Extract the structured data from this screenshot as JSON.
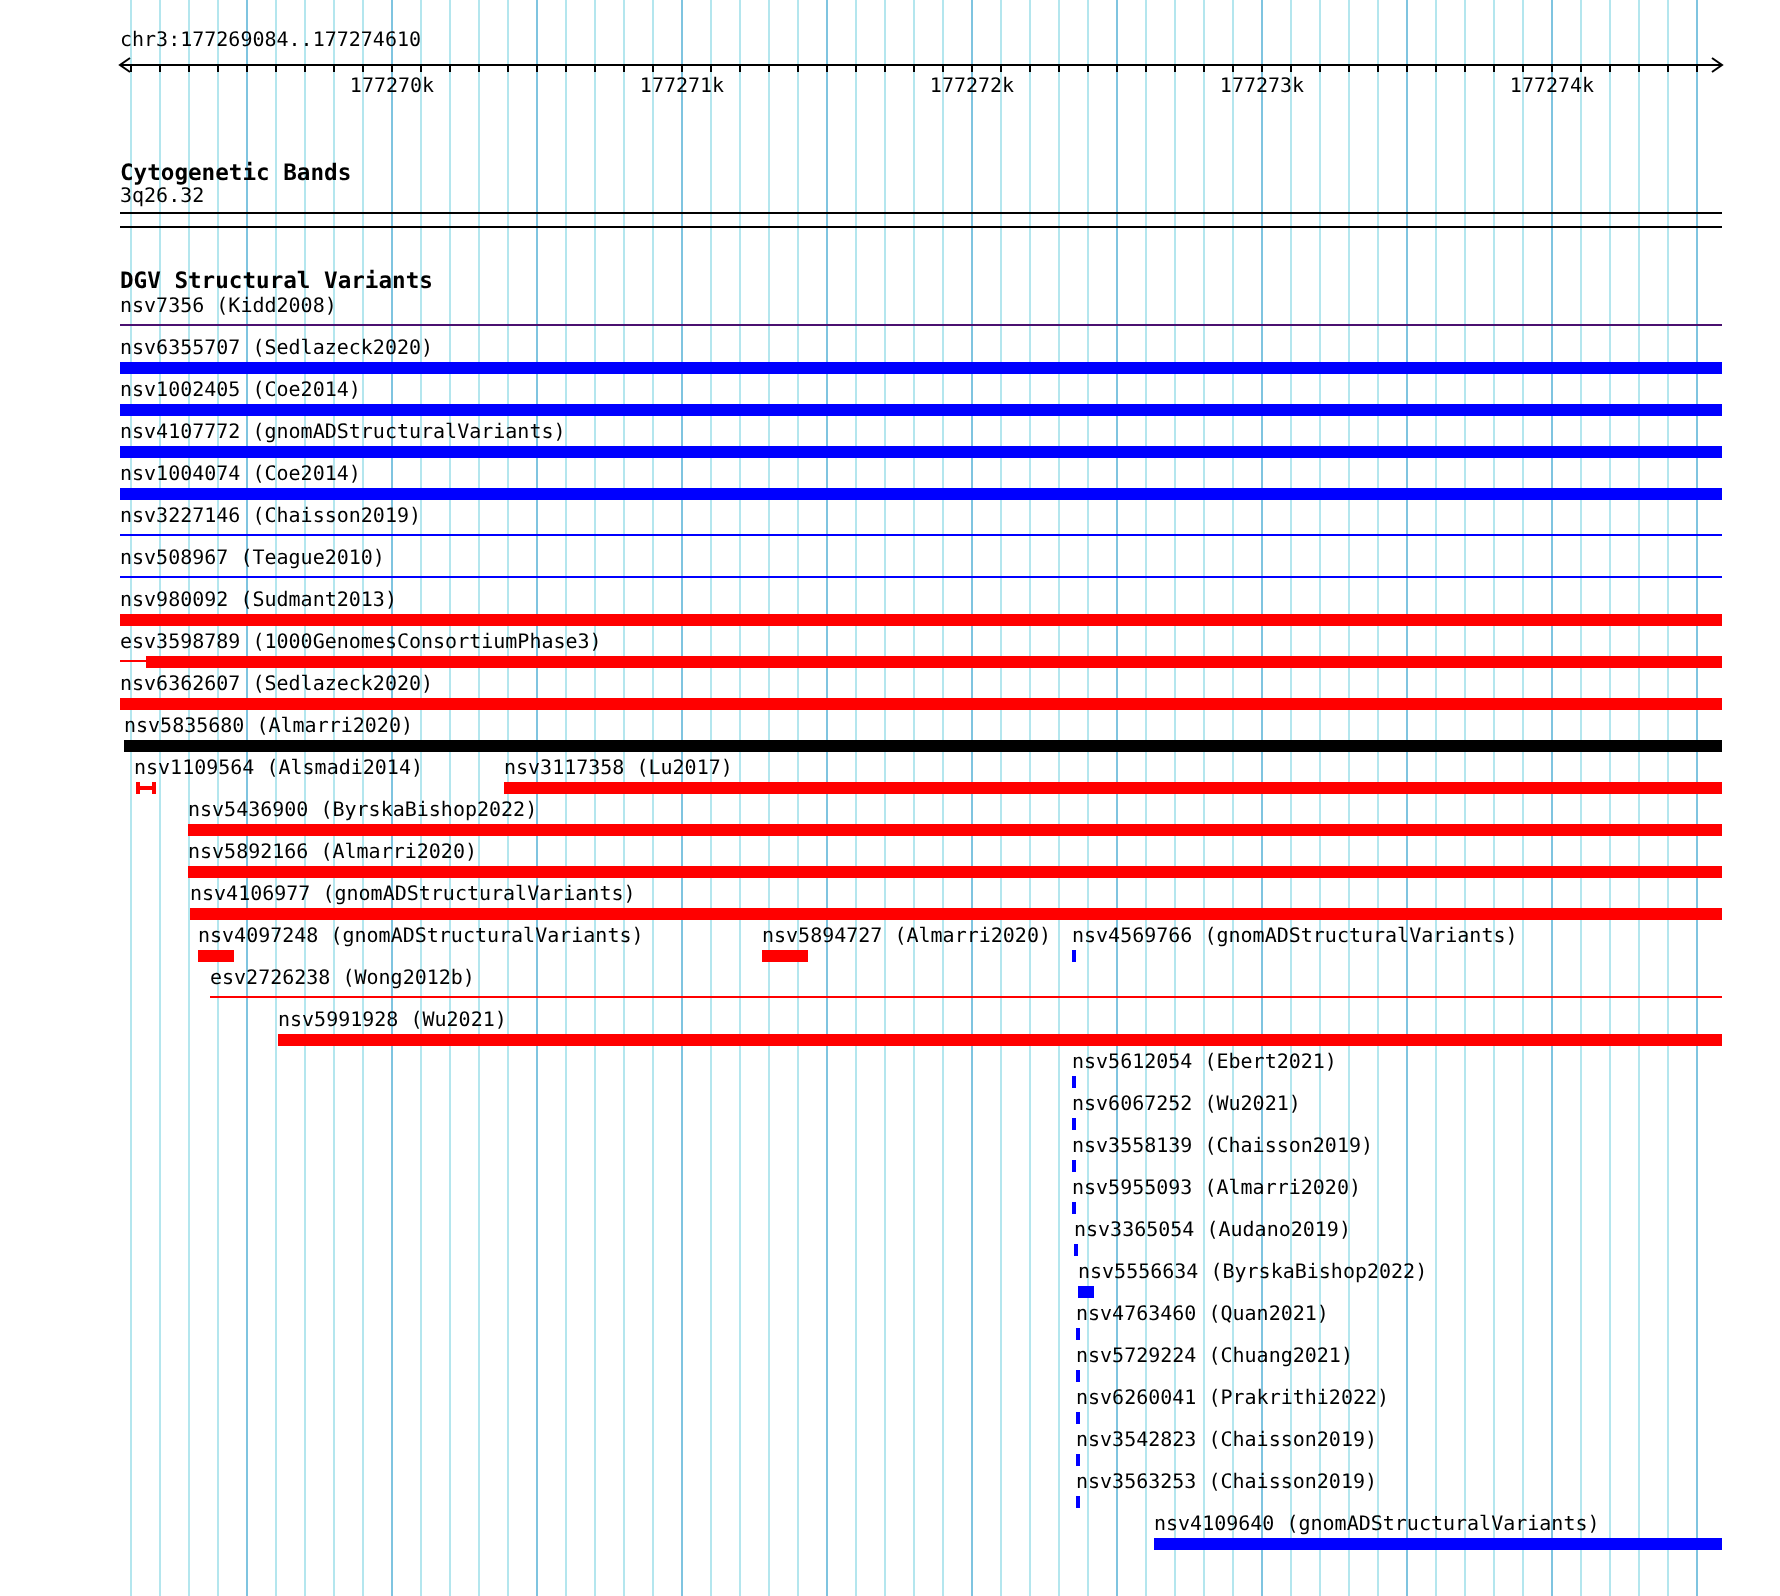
{
  "ruler": {
    "location": "chr3:177269084..177274610",
    "tick_labels": [
      "177270k",
      "177271k",
      "177272k",
      "177273k",
      "177274k"
    ]
  },
  "cytogenetic_track": {
    "title": "Cytogenetic Bands",
    "band": "3q26.32"
  },
  "variant_track": {
    "title": "DGV Structural Variants",
    "features": [
      {
        "label": "nsv7356 (Kidd2008)",
        "color": "#4a1070",
        "kind": "line"
      },
      {
        "label": "nsv6355707 (Sedlazeck2020)",
        "color": "#0000ff",
        "kind": "bar"
      },
      {
        "label": "nsv1002405 (Coe2014)",
        "color": "#0000ff",
        "kind": "bar"
      },
      {
        "label": "nsv4107772 (gnomADStructuralVariants)",
        "color": "#0000ff",
        "kind": "bar"
      },
      {
        "label": "nsv1004074 (Coe2014)",
        "color": "#0000ff",
        "kind": "bar"
      },
      {
        "label": "nsv3227146 (Chaisson2019)",
        "color": "#0000ff",
        "kind": "line"
      },
      {
        "label": "nsv508967 (Teague2010)",
        "color": "#0000ff",
        "kind": "line"
      },
      {
        "label": "nsv980092 (Sudmant2013)",
        "color": "#ff0000",
        "kind": "bar"
      },
      {
        "label": "esv3598789 (1000GenomesConsortiumPhase3)",
        "color": "#ff0000",
        "kind": "bar_tail"
      },
      {
        "label": "nsv6362607 (Sedlazeck2020)",
        "color": "#ff0000",
        "kind": "bar"
      },
      {
        "label": "nsv5835680 (Almarri2020)",
        "color": "#000000",
        "kind": "bar"
      },
      {
        "label": "nsv1109564 (Alsmadi2014)",
        "color": "#ff0000",
        "kind": "capped"
      },
      {
        "label": "nsv3117358 (Lu2017)",
        "color": "#ff0000",
        "kind": "bar"
      },
      {
        "label": "nsv5436900 (ByrskaBishop2022)",
        "color": "#ff0000",
        "kind": "bar"
      },
      {
        "label": "nsv5892166 (Almarri2020)",
        "color": "#ff0000",
        "kind": "bar"
      },
      {
        "label": "nsv4106977 (gnomADStructuralVariants)",
        "color": "#ff0000",
        "kind": "bar"
      },
      {
        "label": "nsv4097248 (gnomADStructuralVariants)",
        "color": "#ff0000",
        "kind": "bar"
      },
      {
        "label": "nsv5894727 (Almarri2020)",
        "color": "#ff0000",
        "kind": "bar"
      },
      {
        "label": "nsv4569766 (gnomADStructuralVariants)",
        "color": "#0000ff",
        "kind": "bar"
      },
      {
        "label": "esv2726238 (Wong2012b)",
        "color": "#ff0000",
        "kind": "line"
      },
      {
        "label": "nsv5991928 (Wu2021)",
        "color": "#ff0000",
        "kind": "bar"
      },
      {
        "label": "nsv5612054 (Ebert2021)",
        "color": "#0000ff",
        "kind": "bar"
      },
      {
        "label": "nsv6067252 (Wu2021)",
        "color": "#0000ff",
        "kind": "bar"
      },
      {
        "label": "nsv3558139 (Chaisson2019)",
        "color": "#0000ff",
        "kind": "bar"
      },
      {
        "label": "nsv5955093 (Almarri2020)",
        "color": "#0000ff",
        "kind": "bar"
      },
      {
        "label": "nsv3365054 (Audano2019)",
        "color": "#0000ff",
        "kind": "bar"
      },
      {
        "label": "nsv5556634 (ByrskaBishop2022)",
        "color": "#0000ff",
        "kind": "bar"
      },
      {
        "label": "nsv4763460 (Quan2021)",
        "color": "#0000ff",
        "kind": "bar"
      },
      {
        "label": "nsv5729224 (Chuang2021)",
        "color": "#0000ff",
        "kind": "bar"
      },
      {
        "label": "nsv6260041 (Prakrithi2022)",
        "color": "#0000ff",
        "kind": "bar"
      },
      {
        "label": "nsv3542823 (Chaisson2019)",
        "color": "#0000ff",
        "kind": "bar"
      },
      {
        "label": "nsv3563253 (Chaisson2019)",
        "color": "#0000ff",
        "kind": "bar"
      },
      {
        "label": "nsv4109640 (gnomADStructuralVariants)",
        "color": "#0000ff",
        "kind": "bar"
      }
    ]
  }
}
